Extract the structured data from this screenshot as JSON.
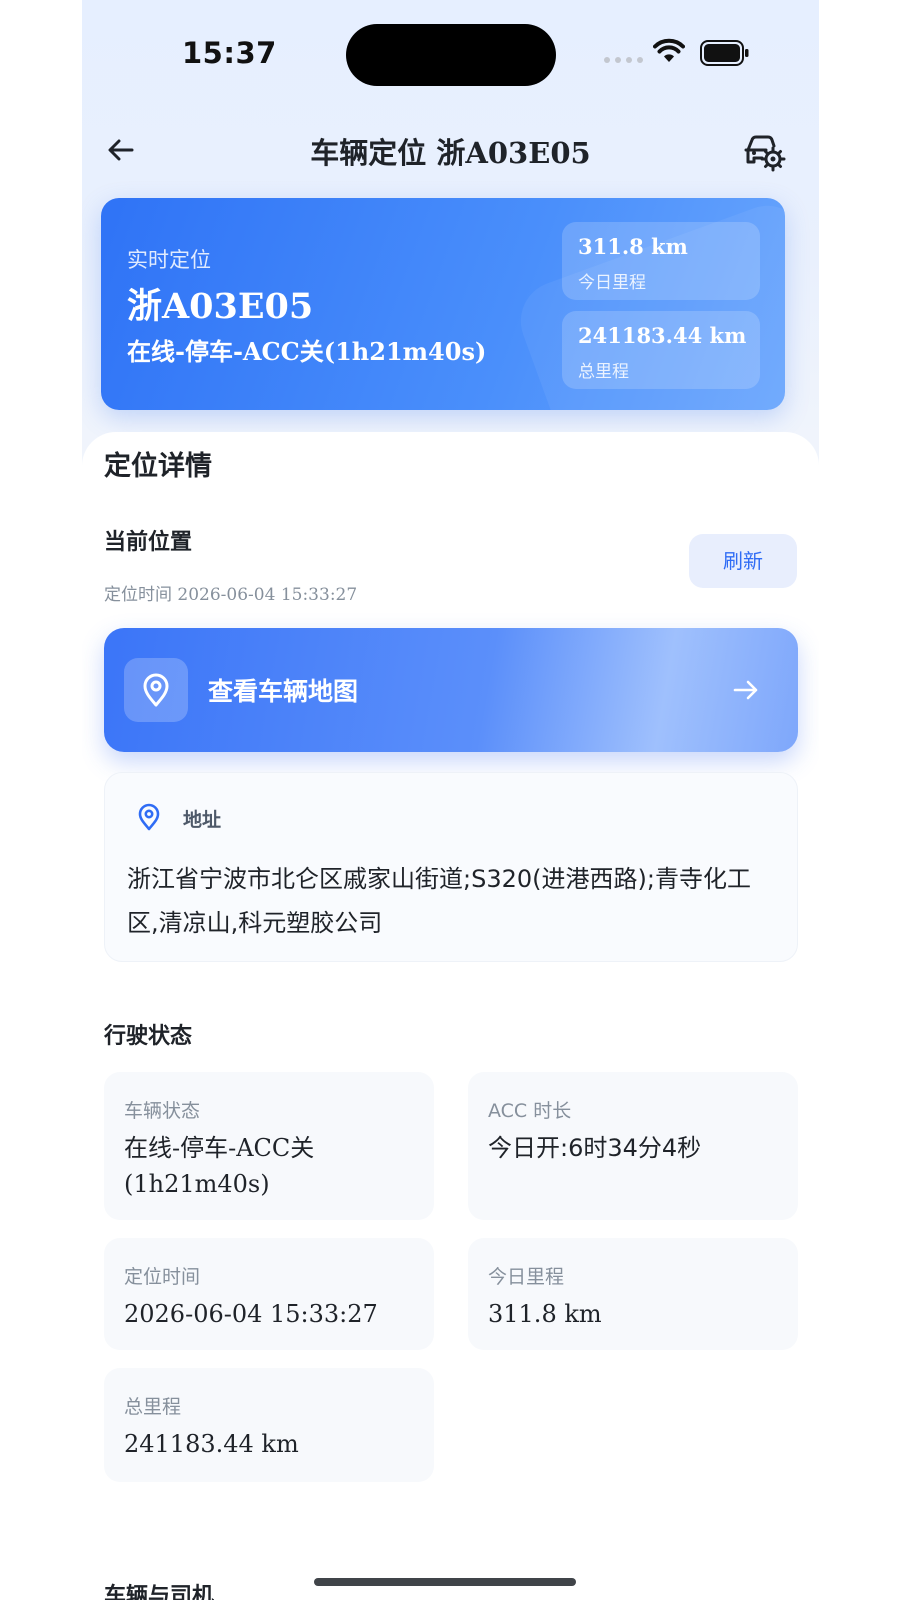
{
  "status_bar": {
    "time": "15:37"
  },
  "nav": {
    "title": "车辆定位 浙A03E05"
  },
  "hero": {
    "label": "实时定位",
    "plate": "浙A03E05",
    "status": "在线-停车-ACC关(1h21m40s)",
    "today_mileage_value": "311.8 km",
    "today_mileage_label": "今日里程",
    "total_mileage_value": "241183.44 km",
    "total_mileage_label": "总里程"
  },
  "details": {
    "title": "定位详情",
    "current_position_label": "当前位置",
    "location_time": "定位时间 2026-06-04 15:33:27",
    "refresh_label": "刷新",
    "map_button_label": "查看车辆地图",
    "address_label": "地址",
    "address_text": "浙江省宁波市北仑区戚家山街道;S320(进港西路);青寺化工区,清凉山,科元塑胶公司"
  },
  "driving": {
    "title": "行驶状态",
    "cards": [
      {
        "label": "车辆状态",
        "value": "在线-停车-ACC关(1h21m40s)"
      },
      {
        "label": "ACC 时长",
        "value": "今日开:6时34分4秒"
      },
      {
        "label": "定位时间",
        "value": "2026-06-04 15:33:27"
      },
      {
        "label": "今日里程",
        "value": "311.8 km"
      },
      {
        "label": "总里程",
        "value": "241183.44 km"
      }
    ]
  },
  "next_section": {
    "title": "车辆与司机"
  },
  "colors": {
    "accent": "#2f6cf5",
    "hero_start": "#2f73f6",
    "hero_end": "#6aa6fd"
  }
}
